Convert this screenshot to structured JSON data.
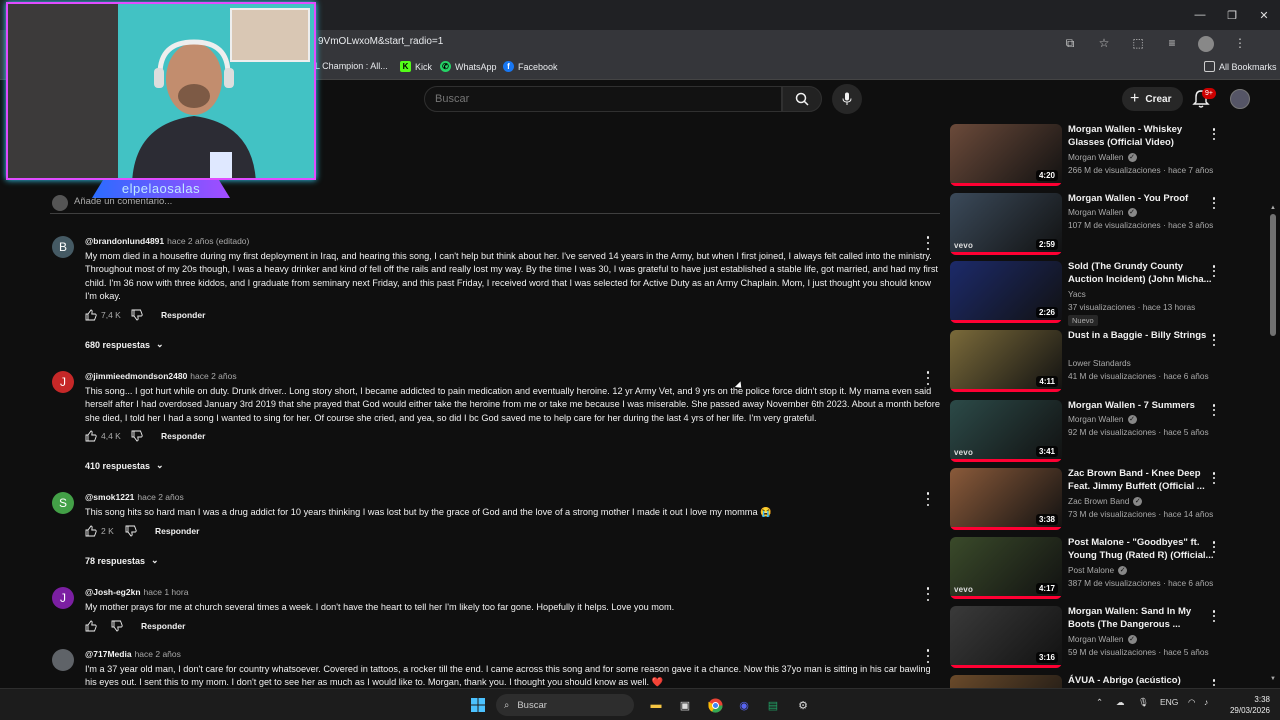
{
  "browser": {
    "url": "9VmOLwxoM&start_radio=1",
    "bookmarks": [
      {
        "label": "oL Champion : All...",
        "icon": "champion-icon"
      },
      {
        "label": "Kick",
        "icon": "kick-icon"
      },
      {
        "label": "WhatsApp",
        "icon": "whatsapp-icon"
      },
      {
        "label": "Facebook",
        "icon": "facebook-icon"
      }
    ],
    "all_bookmarks": "All Bookmarks"
  },
  "header": {
    "search_placeholder": "Buscar",
    "create_label": "Crear",
    "notification_count": "9+"
  },
  "webcam": {
    "nickname": "elpelaosalas",
    "border_color": "#e04cff",
    "glow_color": "#36d8ff"
  },
  "comments": {
    "add_placeholder": "Añade un comentario...",
    "reply_label": "Responder",
    "items": [
      {
        "initial": "B",
        "avatar_color": "#455a64",
        "author": "@brandonlund4891",
        "time": "hace 2 años (editado)",
        "text": "My mom died in a housefire during my first deployment in Iraq, and hearing this song, I can't help but think about her.  I've served 14 years in the Army, but when I first joined, I always felt called into the ministry.  Throughout most of my 20s though, I was a heavy drinker and kind of fell off the rails and really lost my way.  By the time I was 30, I was grateful to have just established a stable life, got married, and had my first child.  I'm 36 now with three kiddos, and I graduate from seminary next Friday, and this past Friday, I received word that I was selected for Active Duty as an Army Chaplain.  Mom, I just thought you should know I'm okay.",
        "likes": "7,4 K",
        "replies": "680 respuestas"
      },
      {
        "initial": "J",
        "avatar_color": "#c62828",
        "author": "@jimmieedmondson2480",
        "time": "hace 2 años",
        "text": "This song... I got hurt while on duty. Drunk driver.. Long story short, I became addicted to pain medication and eventually heroine. 12 yr Army Vet, and 9 yrs on the police force didn't stop it. My mama even said herself after I had overdosed January 3rd 2019 that she prayed that God would either take the heroine from me or take me because I was miserable. She passed away November 6th 2023. About a month before she died, I told her I had a song I wanted to sing for her. Of course she cried, and yea, so did I bc God saved me to help care for her during the last 4 yrs of her life. I'm very grateful.",
        "likes": "4,4 K",
        "replies": "410 respuestas"
      },
      {
        "initial": "S",
        "avatar_color": "#43a047",
        "author": "@smok1221",
        "time": "hace 2 años",
        "text": "This song hits so hard man I was a drug addict for 10 years thinking I was lost but by the grace of God and the love of a strong mother I made it out I love my momma 😭",
        "likes": "2 K",
        "replies": "78 respuestas"
      },
      {
        "initial": "J",
        "avatar_color": "#7b1fa2",
        "author": "@Josh-eg2kn",
        "time": "hace 1 hora",
        "text": "My mother prays for me at church several times a week. I don't have the heart to tell her I'm likely too far gone. Hopefully it helps. Love you mom.",
        "likes": "",
        "replies": ""
      },
      {
        "initial": "",
        "avatar_color": "#5f6368",
        "author": "@717Media",
        "time": "hace 2 años",
        "text": "I'm a 37 year old man, I don't care for country whatsoever. Covered in tattoos, a rocker till the end. I came across this song and for some reason gave it a chance. Now this 37yo man is sitting in his car bawling his eyes out. I sent this to my mom. I don't get to see her as much as I would like to. Morgan, thank you. I thought you should know as well. ❤️",
        "likes": "",
        "replies": ""
      }
    ]
  },
  "recommendations": [
    {
      "title": "Morgan Wallen - Whiskey Glasses (Official Video)",
      "channel": "Morgan Wallen",
      "verified": true,
      "meta": "266 M de visualizaciones · hace 7 años",
      "duration": "4:20",
      "vevo": false,
      "thumb": "#6b4a3a",
      "isnew": ""
    },
    {
      "title": "Morgan Wallen - You Proof",
      "channel": "Morgan Wallen",
      "verified": true,
      "meta": "107 M de visualizaciones · hace 3 años",
      "duration": "2:59",
      "vevo": true,
      "thumb": "#3b4a5a",
      "isnew": ""
    },
    {
      "title": "Sold (The Grundy County Auction Incident) (John Micha...",
      "channel": "Yacs",
      "verified": false,
      "meta": "37 visualizaciones · hace 13 horas",
      "duration": "2:26",
      "vevo": false,
      "thumb": "#1c2a6a",
      "isnew": "Nuevo"
    },
    {
      "title": "Dust in a Baggie - Billy Strings",
      "channel": "Lower Standards",
      "verified": false,
      "meta": "41 M de visualizaciones · hace 6 años",
      "duration": "4:11",
      "vevo": false,
      "thumb": "#7a6a3a",
      "isnew": ""
    },
    {
      "title": "Morgan Wallen - 7 Summers",
      "channel": "Morgan Wallen",
      "verified": true,
      "meta": "92 M de visualizaciones · hace 5 años",
      "duration": "3:41",
      "vevo": true,
      "thumb": "#2c4a48",
      "isnew": ""
    },
    {
      "title": "Zac Brown Band - Knee Deep Feat. Jimmy Buffett (Official ...",
      "channel": "Zac Brown Band",
      "verified": true,
      "meta": "73 M de visualizaciones · hace 14 años",
      "duration": "3:38",
      "vevo": false,
      "thumb": "#8a5a3a",
      "isnew": ""
    },
    {
      "title": "Post Malone - \"Goodbyes\" ft. Young Thug (Rated R) (Official...",
      "channel": "Post Malone",
      "verified": true,
      "meta": "387 M de visualizaciones · hace 6 años",
      "duration": "4:17",
      "vevo": true,
      "thumb": "#3a4a2a",
      "isnew": ""
    },
    {
      "title": "Morgan Wallen: Sand In My Boots (The Dangerous ...",
      "channel": "Morgan Wallen",
      "verified": true,
      "meta": "59 M de visualizaciones · hace 5 años",
      "duration": "3:16",
      "vevo": false,
      "thumb": "#3a3a3a",
      "isnew": ""
    },
    {
      "title": "ÁVUA - Abrigo (acústico)",
      "channel": "",
      "verified": false,
      "meta": "",
      "duration": "",
      "vevo": false,
      "thumb": "#6a4a2a",
      "isnew": ""
    }
  ],
  "taskbar": {
    "search_label": "Buscar",
    "lang": "ENG",
    "time": "3:38",
    "date": "29/03/2026"
  },
  "colors": {
    "accent": "#ff0033",
    "bg": "#0f0f0f"
  }
}
